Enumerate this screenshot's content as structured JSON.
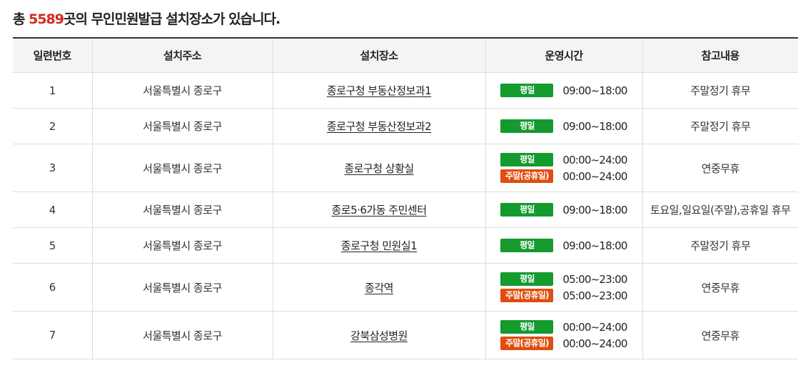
{
  "summary": {
    "prefix": "총 ",
    "count": "5589",
    "suffix": "곳의 무인민원발급 설치장소가 있습니다."
  },
  "colors": {
    "accent_count": "#d7261e",
    "weekday_badge": "#159a2e",
    "weekend_badge": "#e04d10"
  },
  "headers": [
    "일련번호",
    "설치주소",
    "설치장소",
    "운영시간",
    "참고내용"
  ],
  "rows": [
    {
      "no": "1",
      "address": "서울특별시 종로구",
      "place": "종로구청 부동산정보과1",
      "hours": [
        {
          "label": "평일",
          "time": "09:00~18:00"
        }
      ],
      "note": "주말정기 휴무"
    },
    {
      "no": "2",
      "address": "서울특별시 종로구",
      "place": "종로구청 부동산정보과2",
      "hours": [
        {
          "label": "평일",
          "time": "09:00~18:00"
        }
      ],
      "note": "주말정기 휴무"
    },
    {
      "no": "3",
      "address": "서울특별시 종로구",
      "place": "종로구청 상황실",
      "hours": [
        {
          "label": "평일",
          "time": "00:00~24:00"
        },
        {
          "label": "주말(공휴일)",
          "time": "00:00~24:00"
        }
      ],
      "note": "연중무휴"
    },
    {
      "no": "4",
      "address": "서울특별시 종로구",
      "place": "종로5·6가동 주민센터",
      "hours": [
        {
          "label": "평일",
          "time": "09:00~18:00"
        }
      ],
      "note": "토요일,일요일(주말),공휴일 휴무"
    },
    {
      "no": "5",
      "address": "서울특별시 종로구",
      "place": "종로구청 민원실1",
      "hours": [
        {
          "label": "평일",
          "time": "09:00~18:00"
        }
      ],
      "note": "주말정기 휴무"
    },
    {
      "no": "6",
      "address": "서울특별시 종로구",
      "place": "종각역",
      "hours": [
        {
          "label": "평일",
          "time": "05:00~23:00"
        },
        {
          "label": "주말(공휴일)",
          "time": "05:00~23:00"
        }
      ],
      "note": "연중무휴"
    },
    {
      "no": "7",
      "address": "서울특별시 종로구",
      "place": "강북삼성병원",
      "hours": [
        {
          "label": "평일",
          "time": "00:00~24:00"
        },
        {
          "label": "주말(공휴일)",
          "time": "00:00~24:00"
        }
      ],
      "note": "연중무휴"
    }
  ]
}
